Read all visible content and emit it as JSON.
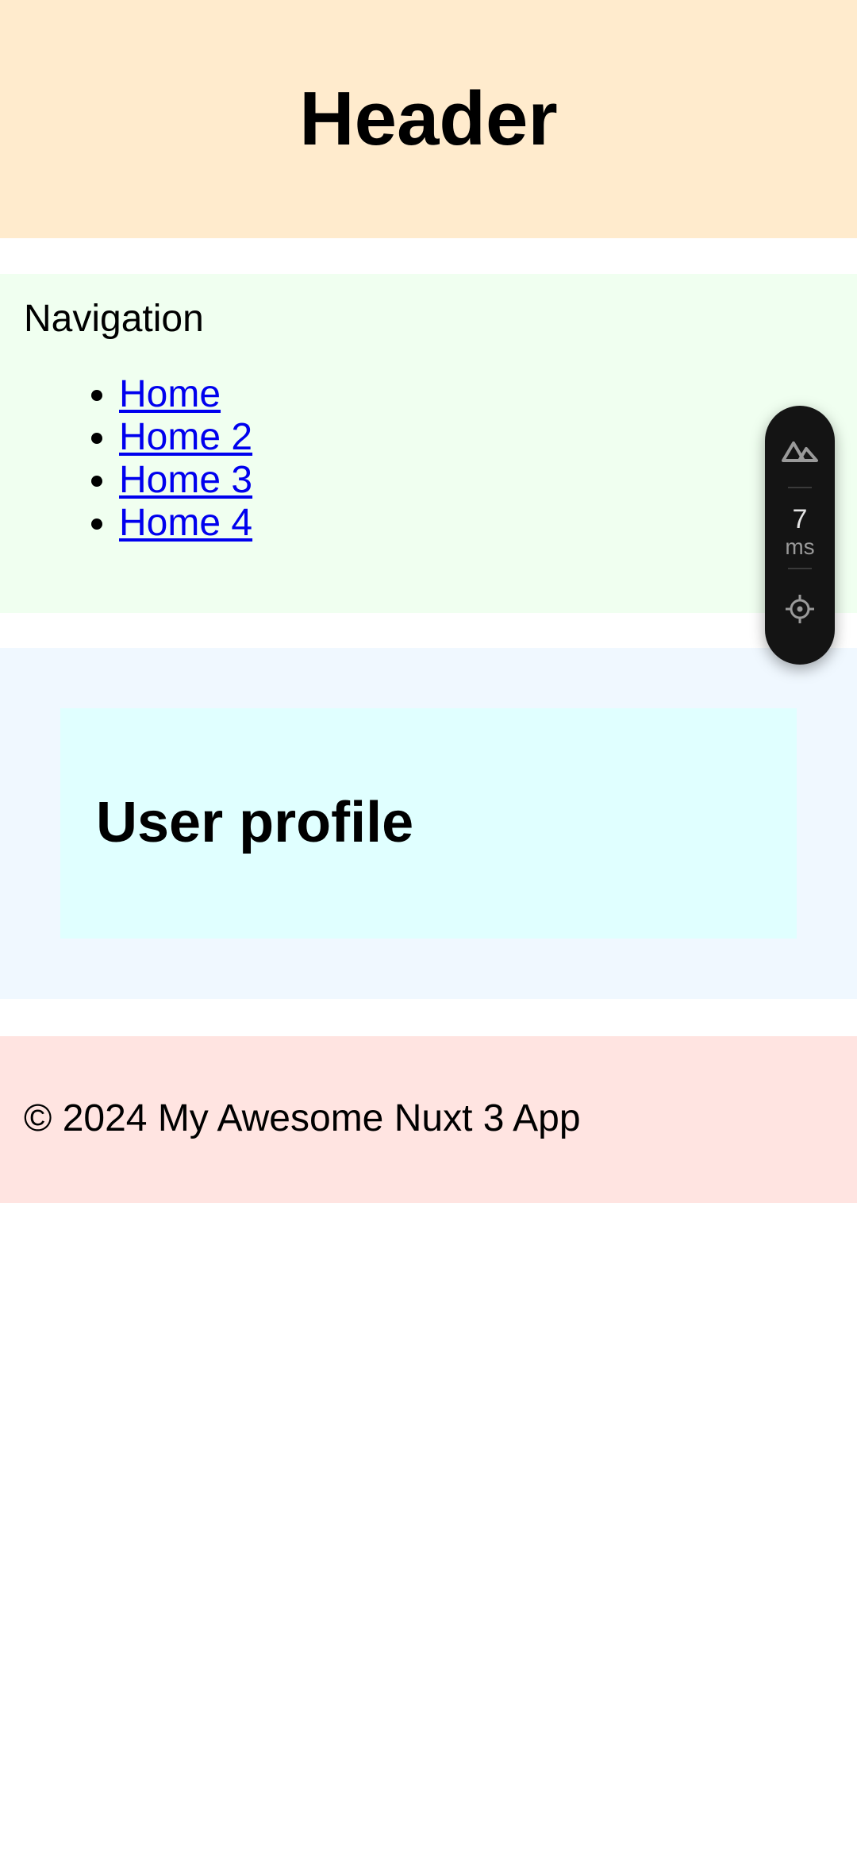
{
  "header": {
    "title": "Header"
  },
  "navigation": {
    "title": "Navigation",
    "links": [
      {
        "label": "Home"
      },
      {
        "label": "Home 2"
      },
      {
        "label": "Home 3"
      },
      {
        "label": "Home 4"
      }
    ]
  },
  "main": {
    "profile_title": "User profile"
  },
  "footer": {
    "text": "© 2024 My Awesome Nuxt 3 App"
  },
  "devtools": {
    "render_time_value": "7",
    "render_time_unit": "ms",
    "icons": [
      "nuxt-logo-icon",
      "inspect-crosshair-icon"
    ]
  },
  "colors": {
    "header_bg": "#ffebcd",
    "nav_bg": "#f0fff0",
    "main_bg": "#f0f8ff",
    "profile_bg": "#e0ffff",
    "footer_bg": "#ffe4e1",
    "link": "#0000ee",
    "devtools_bg": "#141414"
  }
}
